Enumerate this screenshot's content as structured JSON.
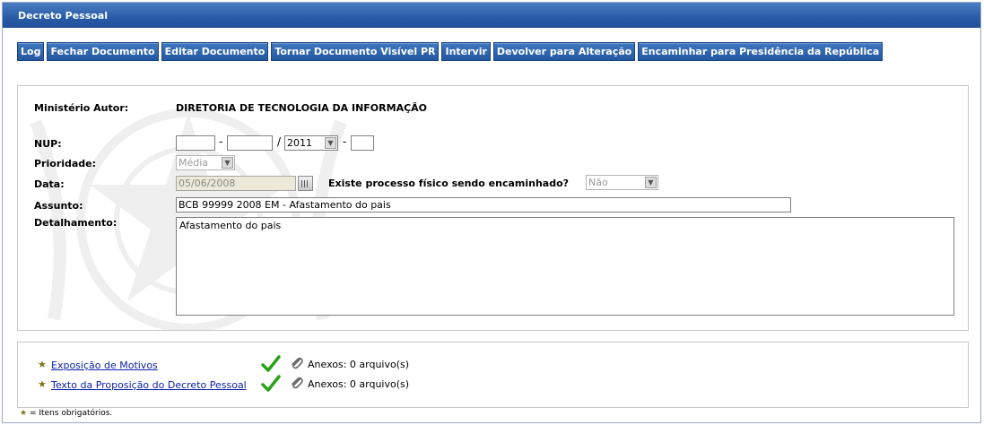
{
  "window": {
    "title": "Decreto Pessoal"
  },
  "toolbar": {
    "log": "Log",
    "fechar": "Fechar Documento",
    "editar": "Editar Documento",
    "tornar_visivel": "Tornar Documento Visível PR",
    "intervir": "Intervir",
    "devolver": "Devolver para Alteração",
    "encaminhar": "Encaminhar para Presidência da República"
  },
  "form": {
    "ministerio_label": "Ministério Autor:",
    "ministerio_value": "DIRETORIA DE TECNOLOGIA DA INFORMAÇÃO",
    "nup_label": "NUP:",
    "nup_part1": "",
    "nup_part2": "",
    "nup_year": "2011",
    "nup_part4": "",
    "nup_sep_dash": "-",
    "nup_sep_slash": "/",
    "prioridade_label": "Prioridade:",
    "prioridade_value": "Média",
    "data_label": "Data:",
    "data_value": "05/06/2008",
    "processo_label": "Existe processo físico sendo encaminhado?",
    "processo_value": "Não",
    "assunto_label": "Assunto:",
    "assunto_value": "BCB 99999 2008 EM - Afastamento do pais",
    "detalhamento_label": "Detalhamento:",
    "detalhamento_value": "Afastamento do pais"
  },
  "attachments": [
    {
      "name": "Exposição de Motivos",
      "anexos": "Anexos: 0 arquivo(s)"
    },
    {
      "name": "Texto da Proposição do Decreto Pessoal",
      "anexos": "Anexos: 0 arquivo(s)"
    }
  ],
  "legend": {
    "star": "★",
    "text": " = Itens obrigatórios."
  },
  "icons": {
    "check": "check-icon",
    "clip": "paperclip-icon",
    "star": "star-icon",
    "calendar": "calendar-icon"
  },
  "colors": {
    "title_bar": "#2a5ea8",
    "button": "#2f66ae",
    "link": "#0b1ea8",
    "check": "#2aa11a",
    "star": "#7d7415"
  }
}
